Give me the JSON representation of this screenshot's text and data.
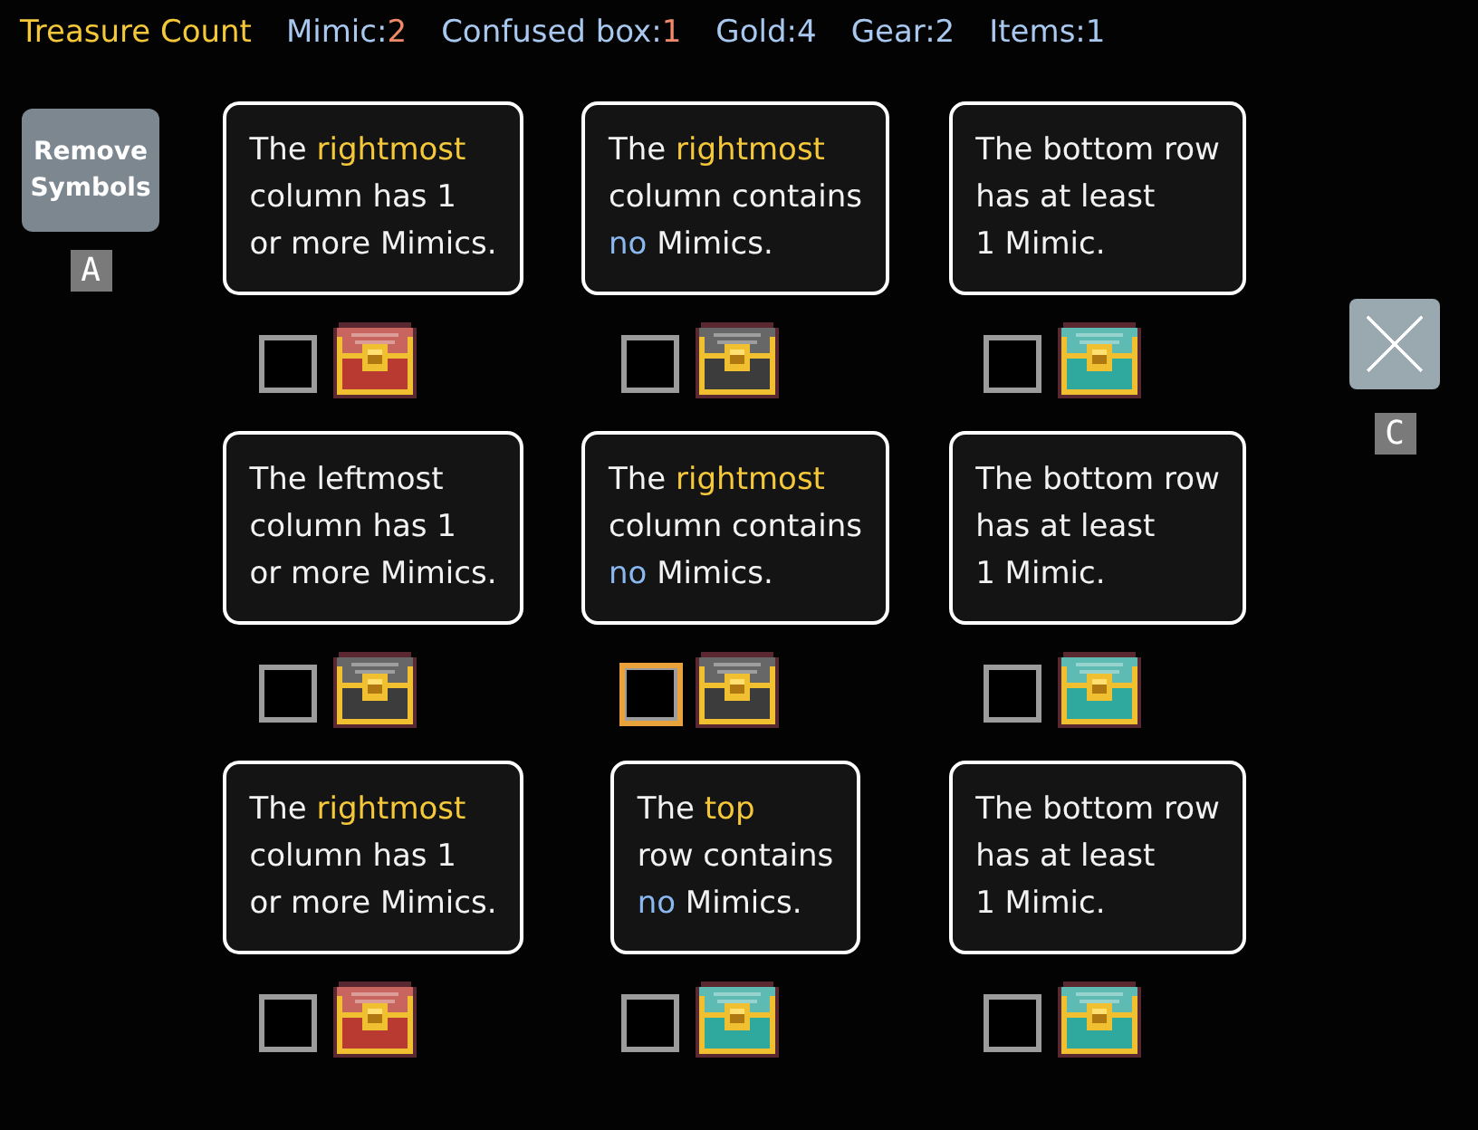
{
  "header": {
    "title": "Treasure Count",
    "counts": [
      {
        "label": "Mimic:",
        "value": "2",
        "color": "#f08a6a"
      },
      {
        "label": "Confused box:",
        "value": "1",
        "color": "#f08a6a"
      },
      {
        "label": "Gold:",
        "value": "4",
        "color": "#a8c8f0"
      },
      {
        "label": "Gear:",
        "value": "2",
        "color": "#a8c8f0"
      },
      {
        "label": "Items:",
        "value": "1",
        "color": "#a8c8f0"
      }
    ]
  },
  "remove_button": {
    "label": "Remove Symbols",
    "key": "A"
  },
  "close_button": {
    "key": "C"
  },
  "rows": [
    [
      {
        "clue": [
          [
            {
              "text": "The ",
              "color": "#f2f2f2"
            },
            {
              "text": "rightmost",
              "color": "#f5c83a"
            }
          ],
          [
            {
              "text": "column has 1",
              "color": "#f2f2f2"
            }
          ],
          [
            {
              "text": "or more Mimics.",
              "color": "#f2f2f2"
            }
          ]
        ],
        "checked": false,
        "selected": false,
        "chest": {
          "color": "#b83a30"
        }
      },
      {
        "clue": [
          [
            {
              "text": "The ",
              "color": "#f2f2f2"
            },
            {
              "text": "rightmost",
              "color": "#f5c83a"
            }
          ],
          [
            {
              "text": "column contains",
              "color": "#f2f2f2"
            }
          ],
          [
            {
              "text": "no",
              "color": "#8ab8f0"
            },
            {
              "text": " Mimics.",
              "color": "#f2f2f2"
            }
          ]
        ],
        "checked": false,
        "selected": false,
        "chest": {
          "color": "#3c3c3c"
        }
      },
      {
        "clue": [
          [
            {
              "text": "The bottom row",
              "color": "#f2f2f2"
            }
          ],
          [
            {
              "text": "has at least",
              "color": "#f2f2f2"
            }
          ],
          [
            {
              "text": "1 Mimic.",
              "color": "#f2f2f2"
            }
          ]
        ],
        "checked": false,
        "selected": false,
        "chest": {
          "color": "#2fa89e"
        }
      }
    ],
    [
      {
        "clue": [
          [
            {
              "text": "The leftmost",
              "color": "#f2f2f2"
            }
          ],
          [
            {
              "text": "column has 1",
              "color": "#f2f2f2"
            }
          ],
          [
            {
              "text": "or more Mimics.",
              "color": "#f2f2f2"
            }
          ]
        ],
        "checked": false,
        "selected": false,
        "chest": {
          "color": "#3c3c3c"
        }
      },
      {
        "clue": [
          [
            {
              "text": "The ",
              "color": "#f2f2f2"
            },
            {
              "text": "rightmost",
              "color": "#f5c83a"
            }
          ],
          [
            {
              "text": "column contains",
              "color": "#f2f2f2"
            }
          ],
          [
            {
              "text": "no",
              "color": "#8ab8f0"
            },
            {
              "text": " Mimics.",
              "color": "#f2f2f2"
            }
          ]
        ],
        "checked": false,
        "selected": true,
        "chest": {
          "color": "#3c3c3c"
        }
      },
      {
        "clue": [
          [
            {
              "text": "The bottom row",
              "color": "#f2f2f2"
            }
          ],
          [
            {
              "text": "has at least",
              "color": "#f2f2f2"
            }
          ],
          [
            {
              "text": "1 Mimic.",
              "color": "#f2f2f2"
            }
          ]
        ],
        "checked": false,
        "selected": false,
        "chest": {
          "color": "#2fa89e"
        }
      }
    ],
    [
      {
        "clue": [
          [
            {
              "text": "The ",
              "color": "#f2f2f2"
            },
            {
              "text": "rightmost",
              "color": "#f5c83a"
            }
          ],
          [
            {
              "text": "column has 1",
              "color": "#f2f2f2"
            }
          ],
          [
            {
              "text": "or more Mimics.",
              "color": "#f2f2f2"
            }
          ]
        ],
        "checked": false,
        "selected": false,
        "chest": {
          "color": "#b83a30"
        }
      },
      {
        "clue": [
          [
            {
              "text": "The ",
              "color": "#f2f2f2"
            },
            {
              "text": "top",
              "color": "#f5c83a"
            }
          ],
          [
            {
              "text": "row contains",
              "color": "#f2f2f2"
            }
          ],
          [
            {
              "text": "no",
              "color": "#8ab8f0"
            },
            {
              "text": " Mimics.",
              "color": "#f2f2f2"
            }
          ]
        ],
        "checked": false,
        "selected": false,
        "chest": {
          "color": "#2fa89e"
        }
      },
      {
        "clue": [
          [
            {
              "text": "The bottom row",
              "color": "#f2f2f2"
            }
          ],
          [
            {
              "text": "has at least",
              "color": "#f2f2f2"
            }
          ],
          [
            {
              "text": "1 Mimic.",
              "color": "#f2f2f2"
            }
          ]
        ],
        "checked": false,
        "selected": false,
        "chest": {
          "color": "#2fa89e"
        }
      }
    ]
  ]
}
